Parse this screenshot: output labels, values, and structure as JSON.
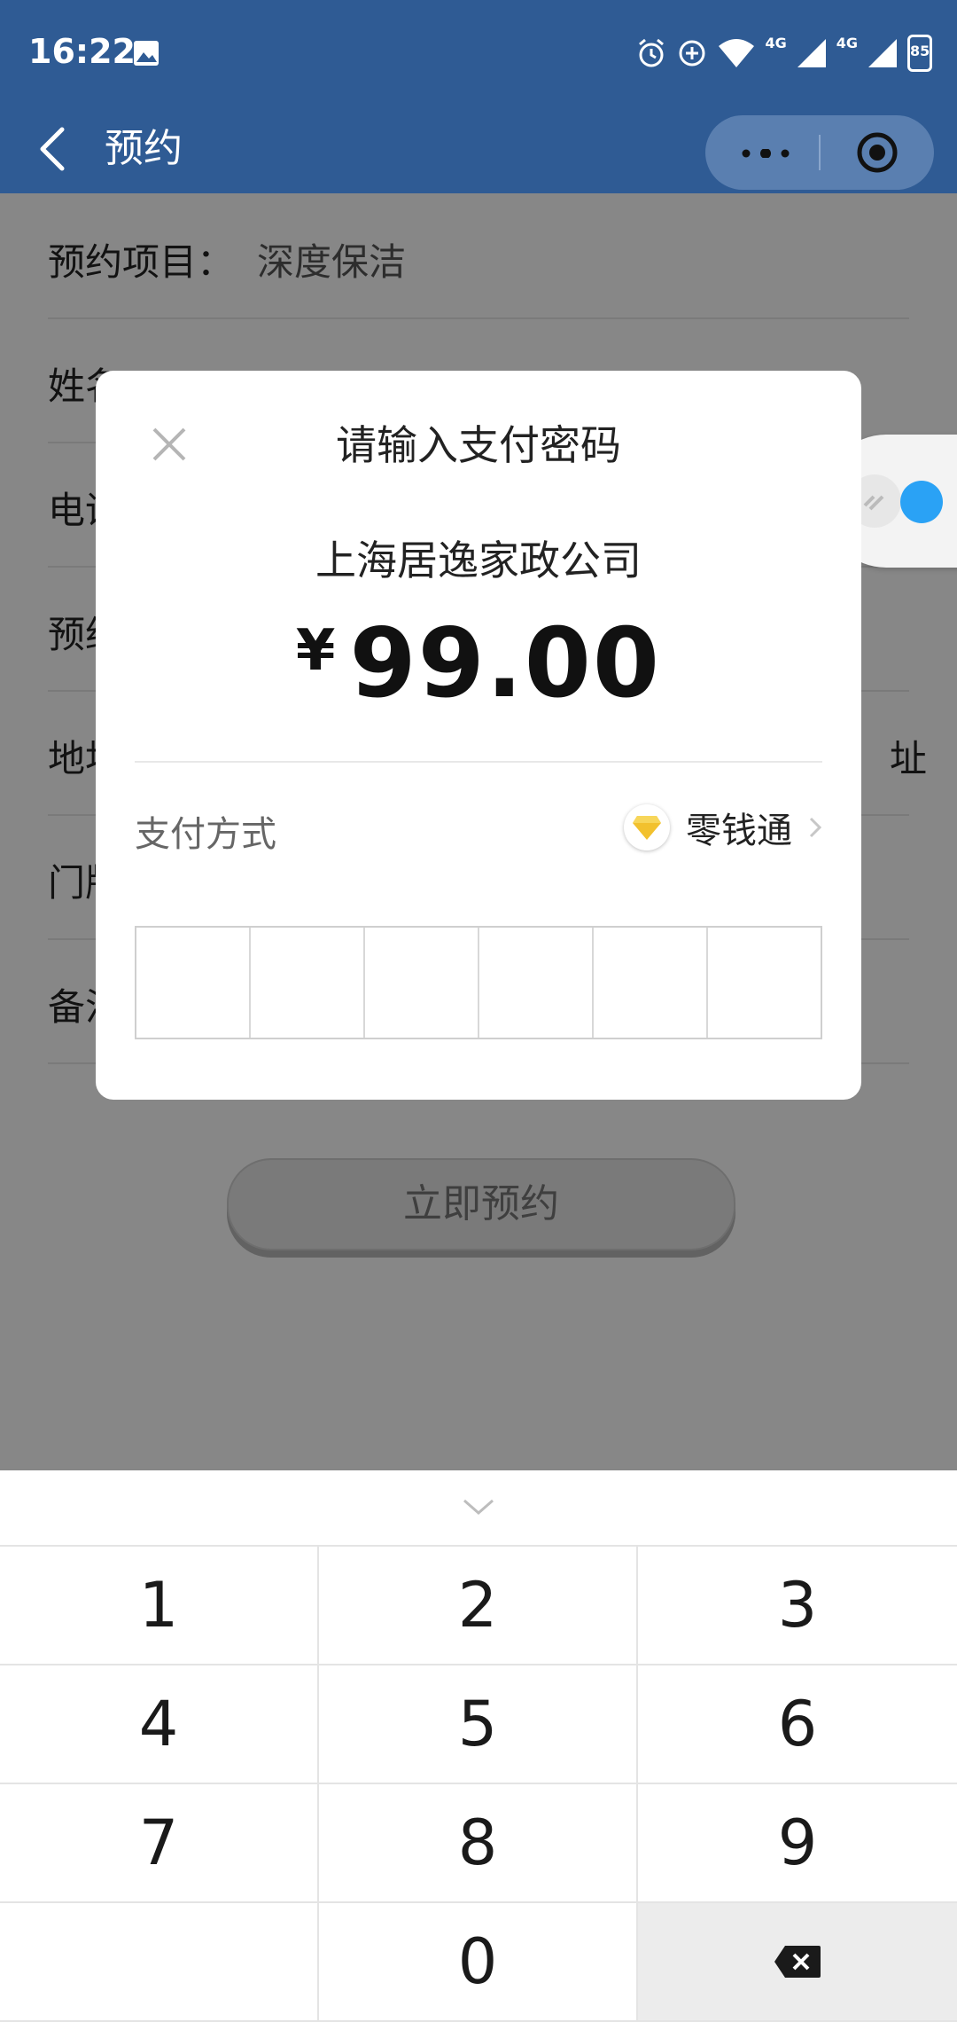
{
  "status_bar": {
    "time": "16:22",
    "network_1": "4G",
    "network_2": "4G",
    "battery": "85",
    "icons": [
      "image-icon",
      "alarm-icon",
      "data-saver-icon",
      "wifi-icon",
      "signal-icon",
      "battery-icon"
    ]
  },
  "navbar": {
    "title": "预约",
    "back_icon": "back-arrow-icon",
    "more_icon": "more-icon",
    "close_mini_icon": "target-icon"
  },
  "form": {
    "rows": [
      {
        "label": "预约项目：",
        "value": "深度保洁",
        "tail": ""
      },
      {
        "label": "姓名",
        "value": "",
        "tail": ""
      },
      {
        "label": "电话",
        "value": "",
        "tail": ""
      },
      {
        "label": "预约",
        "value": "",
        "tail": ""
      },
      {
        "label": "地址",
        "value": "",
        "tail": "址"
      },
      {
        "label": "门牌",
        "value": "",
        "tail": ""
      },
      {
        "label": "备注",
        "value": "",
        "tail": ""
      }
    ],
    "submit_label": "立即预约"
  },
  "dialog": {
    "title": "请输入支付密码",
    "merchant": "上海居逸家政公司",
    "currency": "¥",
    "amount": "99.00",
    "pay_method_label": "支付方式",
    "pay_method": "零钱通",
    "password_digits": 6
  },
  "keyboard": {
    "keys": [
      "1",
      "2",
      "3",
      "4",
      "5",
      "6",
      "7",
      "8",
      "9",
      "",
      "0",
      "⌫"
    ]
  },
  "colors": {
    "nav_blue": "#2f5b94",
    "overlay": "rgba(0,0,0,0.47)",
    "bubble_blue": "#2aa2f5",
    "coin_gold": "#f2c12e"
  }
}
